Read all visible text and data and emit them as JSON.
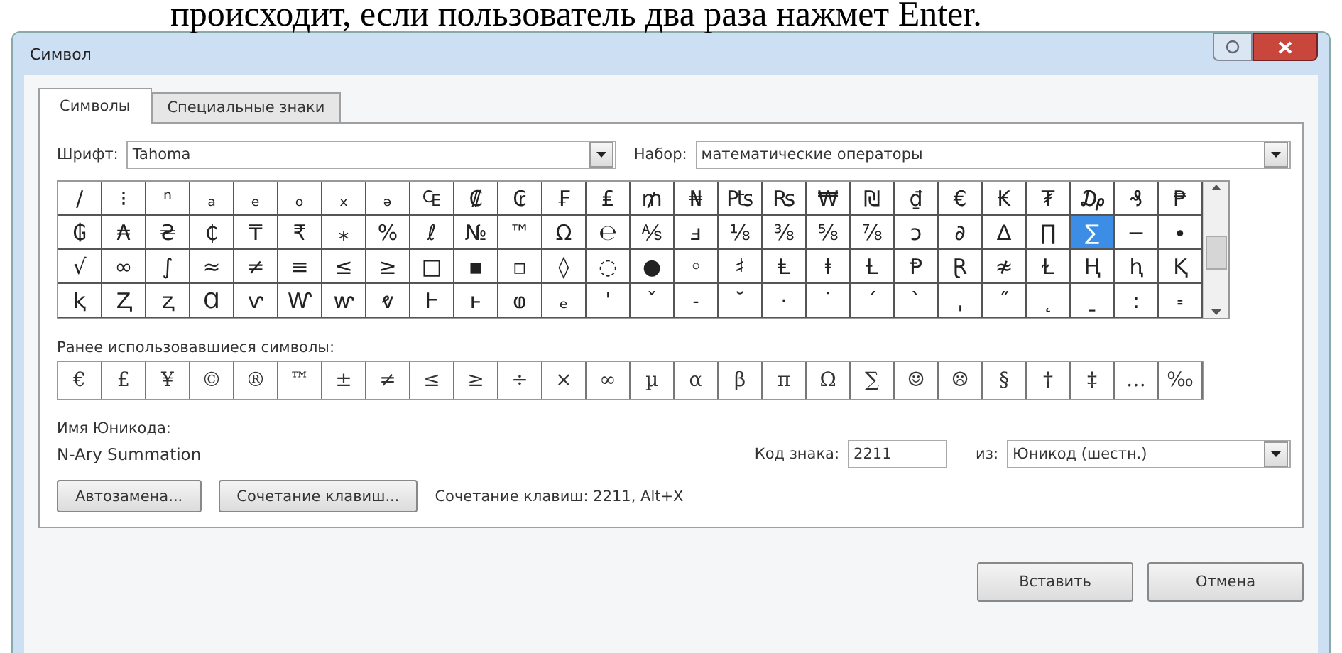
{
  "document_text": "происходит, если пользователь два раза нажмет Enter.",
  "dialog": {
    "title": "Символ",
    "tabs": [
      {
        "label": "Символы",
        "selected": true
      },
      {
        "label": "Специальные знаки",
        "selected": false
      }
    ],
    "font_label": "Шрифт:",
    "font_value": "Tahoma",
    "subset_label": "Набор:",
    "subset_value": "математические операторы",
    "symbol_rows": [
      [
        {
          "char": "/",
          "selected": false
        },
        {
          "char": "⁝",
          "selected": false
        },
        {
          "char": "ⁿ",
          "selected": false
        },
        {
          "char": "ₐ",
          "selected": false
        },
        {
          "char": "ₑ",
          "selected": false
        },
        {
          "char": "ₒ",
          "selected": false
        },
        {
          "char": "ₓ",
          "selected": false
        },
        {
          "char": "ₔ",
          "selected": false
        },
        {
          "char": "₠",
          "selected": false
        },
        {
          "char": "₡",
          "selected": false
        },
        {
          "char": "₢",
          "selected": false
        },
        {
          "char": "₣",
          "selected": false
        },
        {
          "char": "₤",
          "selected": false
        },
        {
          "char": "₥",
          "selected": false
        },
        {
          "char": "₦",
          "selected": false
        },
        {
          "char": "₧",
          "selected": false
        },
        {
          "char": "₨",
          "selected": false
        },
        {
          "char": "₩",
          "selected": false
        },
        {
          "char": "₪",
          "selected": false
        },
        {
          "char": "₫",
          "selected": false
        },
        {
          "char": "€",
          "selected": false
        },
        {
          "char": "₭",
          "selected": false
        },
        {
          "char": "₮",
          "selected": false
        },
        {
          "char": "₯",
          "selected": false
        },
        {
          "char": "₰",
          "selected": false
        },
        {
          "char": "₱",
          "selected": false
        }
      ],
      [
        {
          "char": "₲",
          "selected": false
        },
        {
          "char": "₳",
          "selected": false
        },
        {
          "char": "₴",
          "selected": false
        },
        {
          "char": "₵",
          "selected": false
        },
        {
          "char": "₸",
          "selected": false
        },
        {
          "char": "₹",
          "selected": false
        },
        {
          "char": "⁎",
          "selected": false
        },
        {
          "char": "%",
          "selected": false
        },
        {
          "char": "ℓ",
          "selected": false
        },
        {
          "char": "№",
          "selected": false
        },
        {
          "char": "™",
          "selected": false
        },
        {
          "char": "Ω",
          "selected": false
        },
        {
          "char": "℮",
          "selected": false
        },
        {
          "char": "⅍",
          "selected": false
        },
        {
          "char": "ⅎ",
          "selected": false
        },
        {
          "char": "⅛",
          "selected": false
        },
        {
          "char": "⅜",
          "selected": false
        },
        {
          "char": "⅝",
          "selected": false
        },
        {
          "char": "⅞",
          "selected": false
        },
        {
          "char": "ↄ",
          "selected": false
        },
        {
          "char": "∂",
          "selected": false
        },
        {
          "char": "∆",
          "selected": false
        },
        {
          "char": "∏",
          "selected": false
        },
        {
          "char": "∑",
          "selected": true
        },
        {
          "char": "−",
          "selected": false
        },
        {
          "char": "∙",
          "selected": false
        }
      ],
      [
        {
          "char": "√",
          "selected": false
        },
        {
          "char": "∞",
          "selected": false
        },
        {
          "char": "∫",
          "selected": false
        },
        {
          "char": "≈",
          "selected": false
        },
        {
          "char": "≠",
          "selected": false
        },
        {
          "char": "≡",
          "selected": false
        },
        {
          "char": "≤",
          "selected": false
        },
        {
          "char": "≥",
          "selected": false
        },
        {
          "char": "□",
          "selected": false
        },
        {
          "char": "▪",
          "selected": false
        },
        {
          "char": "▫",
          "selected": false
        },
        {
          "char": "◊",
          "selected": false
        },
        {
          "char": "◌",
          "selected": false
        },
        {
          "char": "●",
          "selected": false
        },
        {
          "char": "◦",
          "selected": false
        },
        {
          "char": "♯",
          "selected": false
        },
        {
          "char": "Ⱡ",
          "selected": false
        },
        {
          "char": "ⱡ",
          "selected": false
        },
        {
          "char": "Ƚ",
          "selected": false
        },
        {
          "char": "Ᵽ",
          "selected": false
        },
        {
          "char": "Ɽ",
          "selected": false
        },
        {
          "char": "≉",
          "selected": false
        },
        {
          "char": "Ɫ",
          "selected": false
        },
        {
          "char": "Ⱨ",
          "selected": false
        },
        {
          "char": "ⱨ",
          "selected": false
        },
        {
          "char": "Ⱪ",
          "selected": false
        }
      ],
      [
        {
          "char": "ⱪ",
          "selected": false
        },
        {
          "char": "Ⱬ",
          "selected": false
        },
        {
          "char": "ⱬ",
          "selected": false
        },
        {
          "char": "Ɑ",
          "selected": false
        },
        {
          "char": "ⱱ",
          "selected": false
        },
        {
          "char": "Ⱳ",
          "selected": false
        },
        {
          "char": "ⱳ",
          "selected": false
        },
        {
          "char": "ⱴ",
          "selected": false
        },
        {
          "char": "Ⱶ",
          "selected": false
        },
        {
          "char": "ⱶ",
          "selected": false
        },
        {
          "char": "ⱷ",
          "selected": false
        },
        {
          "char": "ₑ",
          "selected": false
        },
        {
          "char": "ˈ",
          "selected": false
        },
        {
          "char": "ˇ",
          "selected": false
        },
        {
          "char": "˗",
          "selected": false
        },
        {
          "char": "˘",
          "selected": false
        },
        {
          "char": "·",
          "selected": false
        },
        {
          "char": "˙",
          "selected": false
        },
        {
          "char": "ˊ",
          "selected": false
        },
        {
          "char": "ˋ",
          "selected": false
        },
        {
          "char": "ˌ",
          "selected": false
        },
        {
          "char": "˝",
          "selected": false
        },
        {
          "char": "˛",
          "selected": false
        },
        {
          "char": "ˍ",
          "selected": false
        },
        {
          "char": "꞉",
          "selected": false
        },
        {
          "char": "꞊",
          "selected": false
        }
      ]
    ],
    "recent_label": "Ранее использовавшиеся символы:",
    "recent_symbols": [
      "€",
      "£",
      "¥",
      "©",
      "®",
      "™",
      "±",
      "≠",
      "≤",
      "≥",
      "÷",
      "×",
      "∞",
      "µ",
      "α",
      "β",
      "π",
      "Ω",
      "∑",
      "☺",
      "☹",
      "§",
      "†",
      "‡",
      "…",
      "‰"
    ],
    "unicode_name_label": "Имя Юникода:",
    "unicode_name": "N-Ary Summation",
    "code_label": "Код знака:",
    "code_value": "2211",
    "from_label": "из:",
    "from_value": "Юникод (шестн.)",
    "autocorrect_button": "Автозамена...",
    "shortcut_button": "Сочетание клавиш...",
    "shortcut_text": "Сочетание клавиш: 2211, Alt+X",
    "insert_button": "Вставить",
    "cancel_button": "Отмена"
  }
}
